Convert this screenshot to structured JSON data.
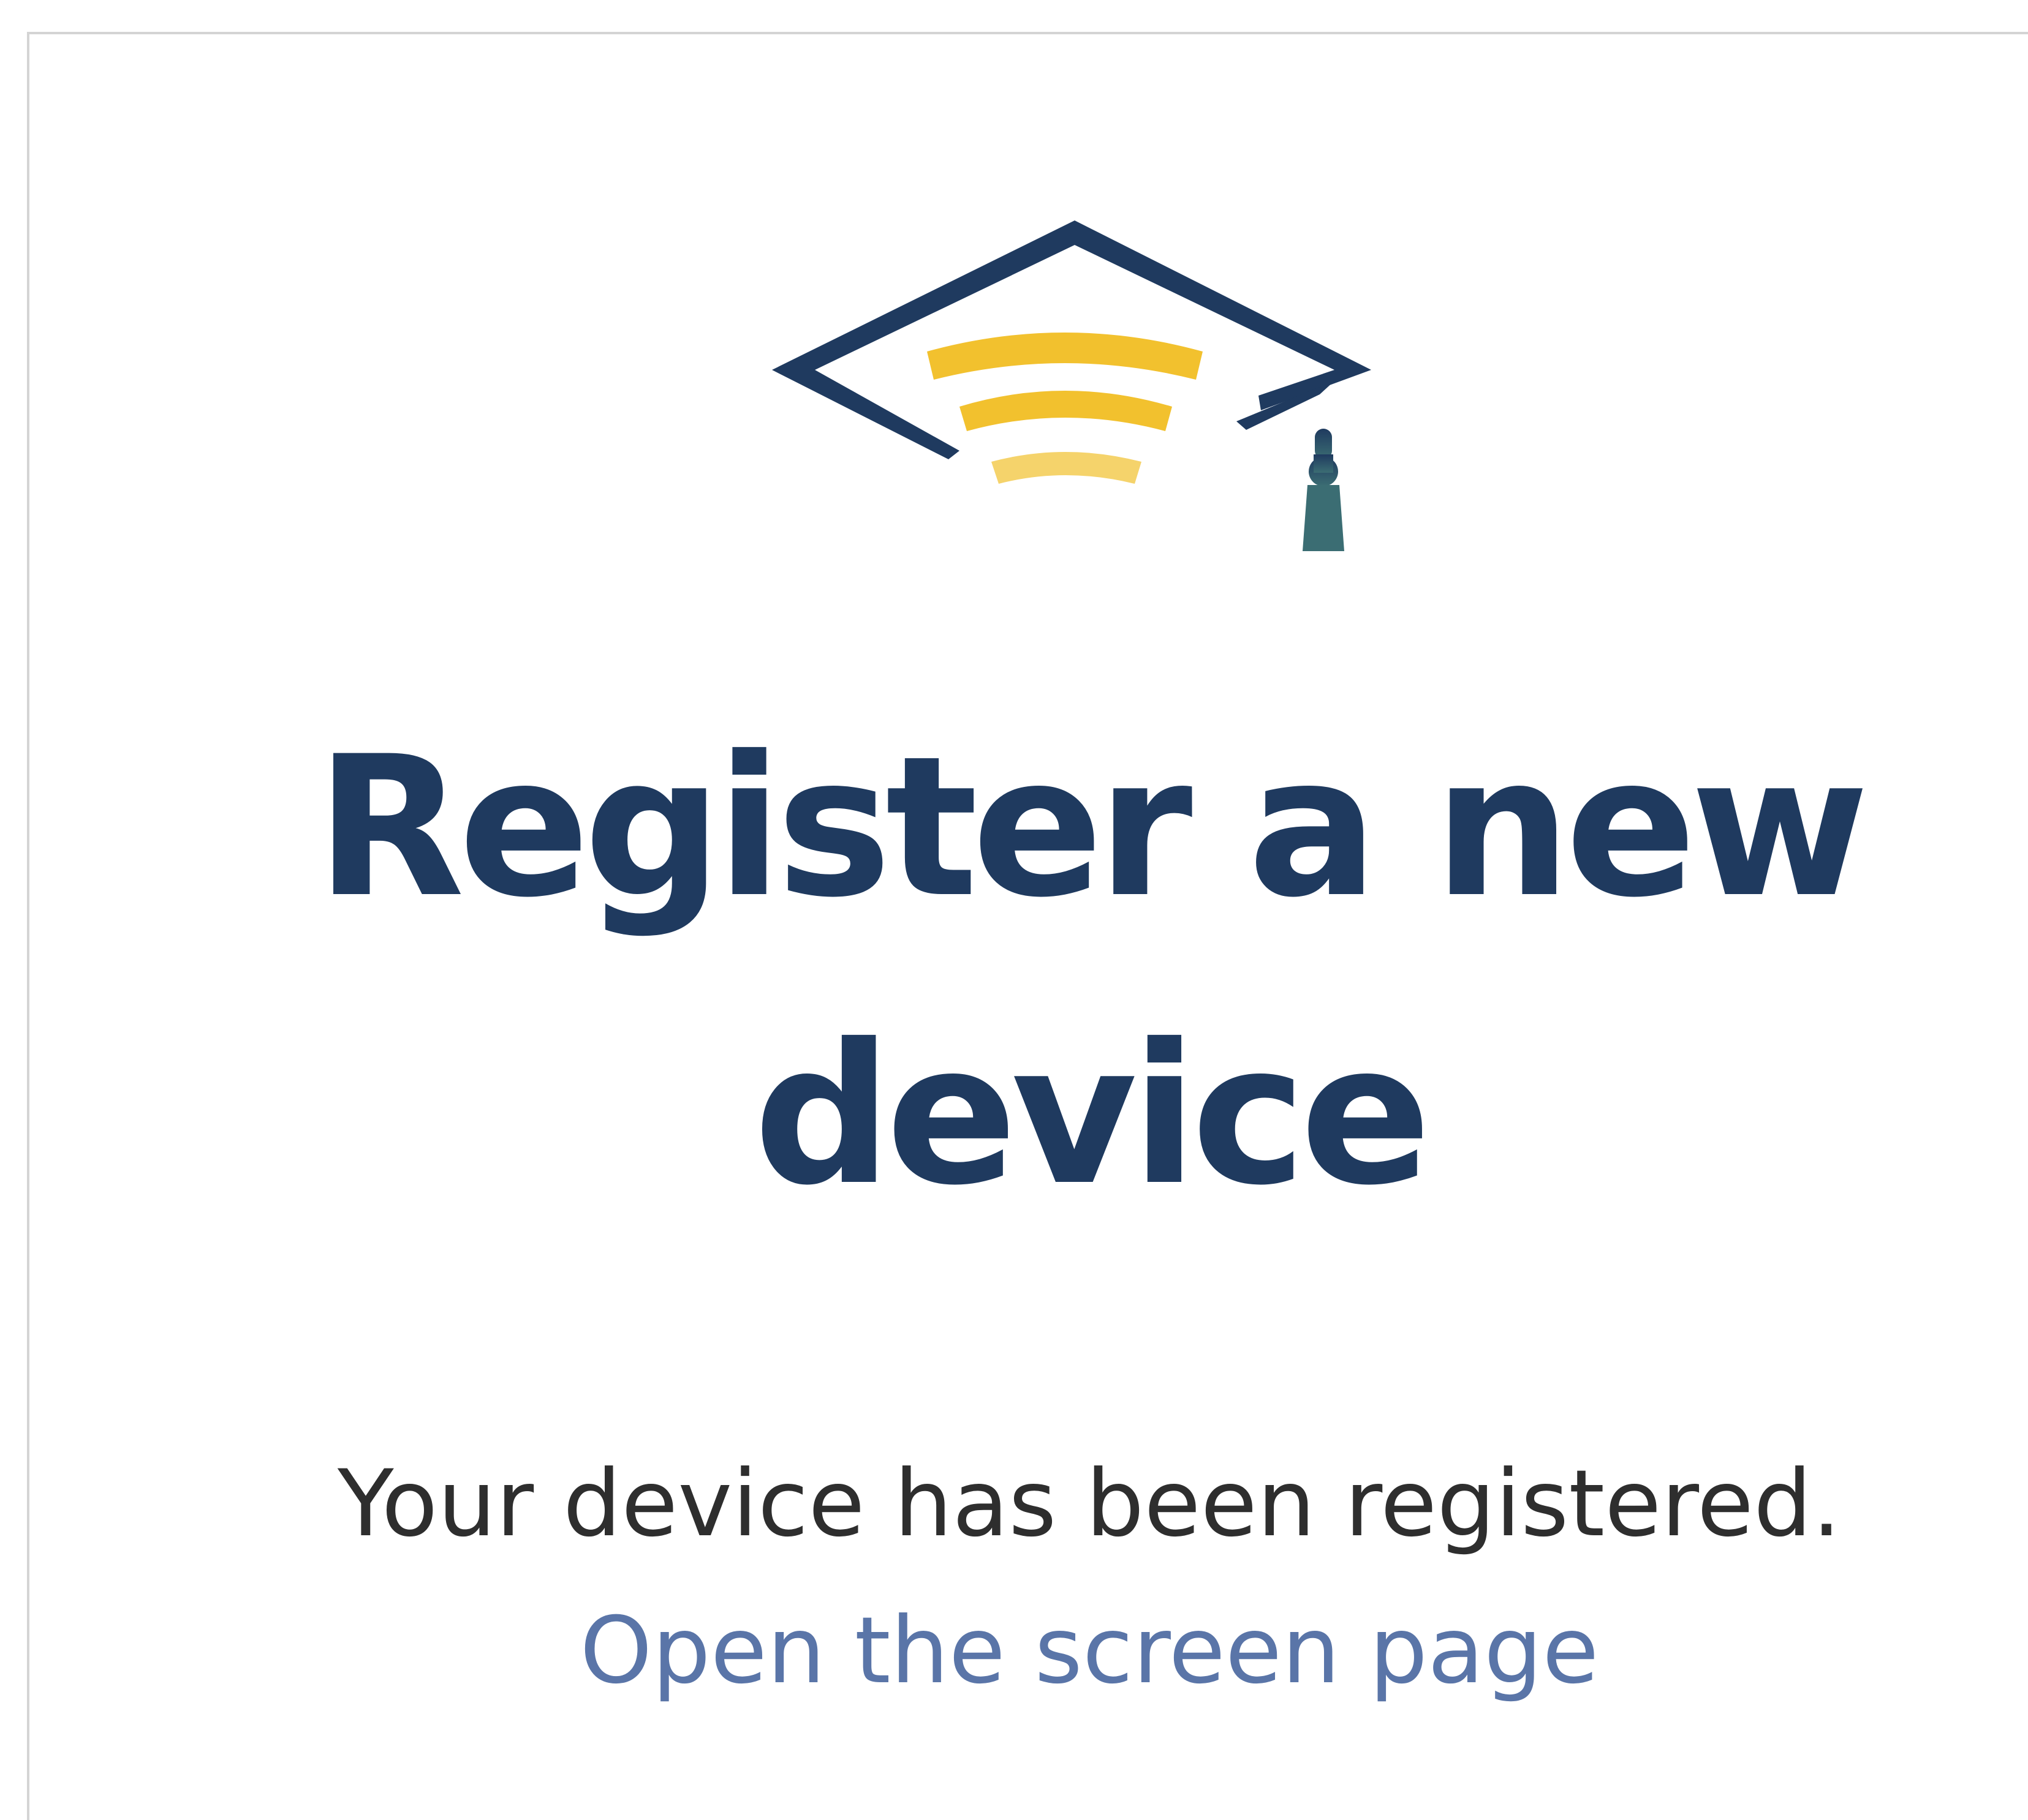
{
  "logo": {
    "icon": "graduation-cap-wifi-icon",
    "colors": {
      "cap": "#1f3a5f",
      "signal": "#f2c12e",
      "signal_light": "#f5d36b",
      "tassel": "#2f5f6b"
    }
  },
  "main": {
    "title": "Register a new device",
    "message": "Your device has been registered.",
    "link_label": "Open the screen page"
  },
  "colors": {
    "title": "#1f3a5f",
    "text": "#2e2e2e",
    "link": "#5a75a8"
  }
}
